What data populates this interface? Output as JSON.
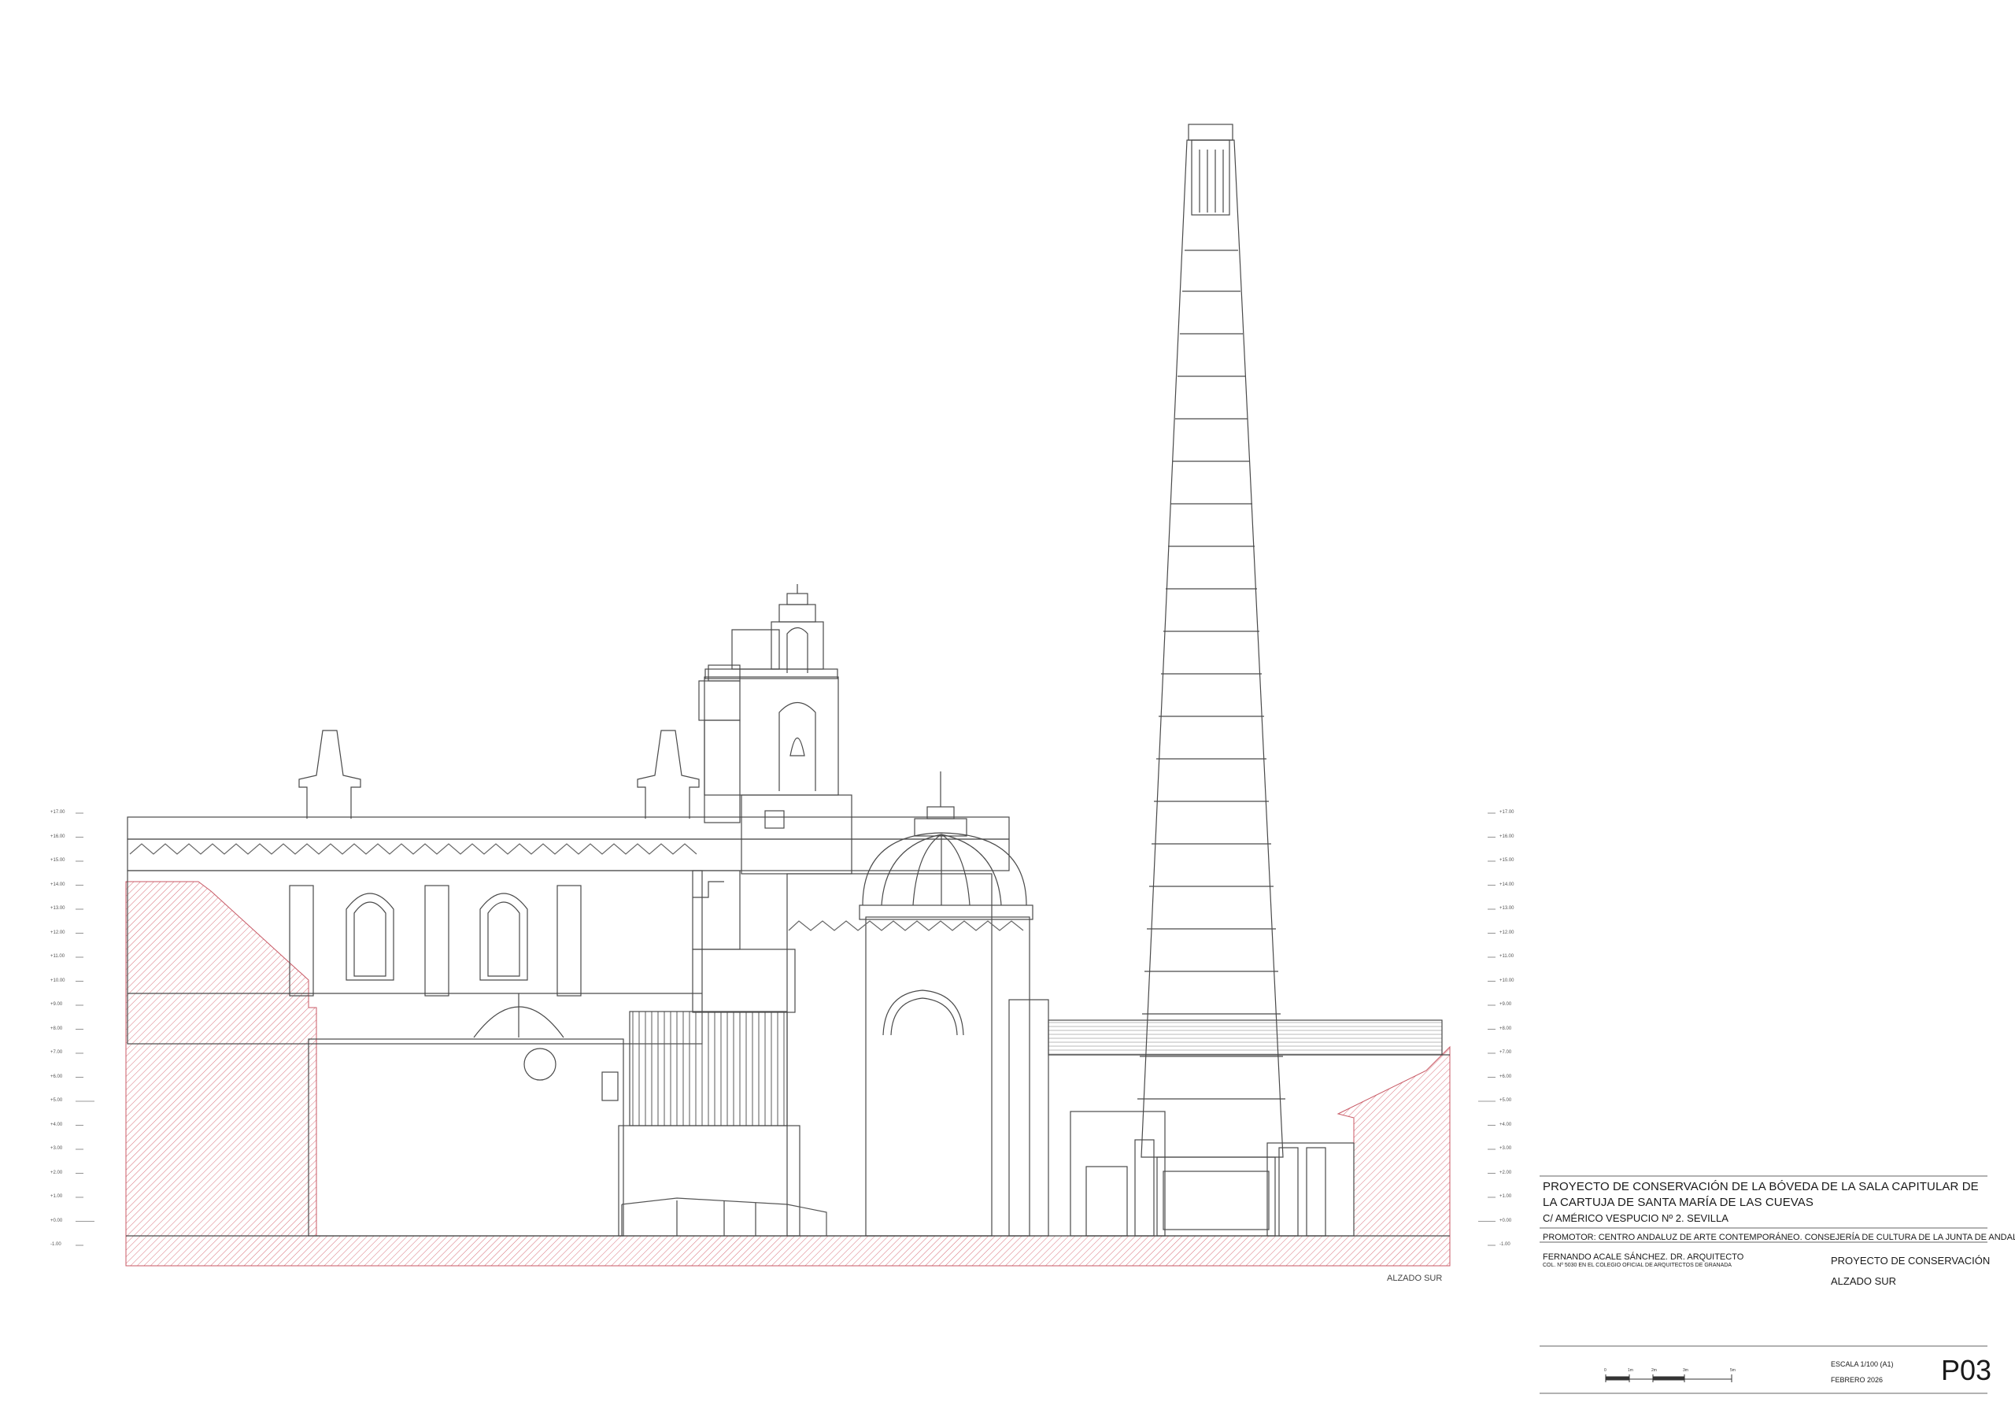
{
  "drawing": {
    "view_label": "ALZADO SUR",
    "levels_left": [
      "+17.00",
      "+16.00",
      "+15.00",
      "+14.00",
      "+13.00",
      "+12.00",
      "+11.00",
      "+10.00",
      "+9.00",
      "+8.00",
      "+7.00",
      "+6.00",
      "+5.00",
      "+4.00",
      "+3.00",
      "+2.00",
      "+1.00",
      "+0.00",
      "-1.00"
    ],
    "levels_right": [
      "+17.00",
      "+16.00",
      "+15.00",
      "+14.00",
      "+13.00",
      "+12.00",
      "+11.00",
      "+10.00",
      "+9.00",
      "+8.00",
      "+7.00",
      "+6.00",
      "+5.00",
      "+4.00",
      "+3.00",
      "+2.00",
      "+1.00",
      "+0.00",
      "-1.00"
    ],
    "colors": {
      "line": "#4a4a4a",
      "section_hatch": "#d9707a",
      "title_rule": "#666666"
    }
  },
  "title_block": {
    "title": "PROYECTO DE CONSERVACIÓN DE LA BÓVEDA DE LA SALA CAPITULAR DE LA CARTUJA DE SANTA MARÍA DE LAS CUEVAS",
    "address": "C/ AMÉRICO VESPUCIO Nº 2. SEVILLA",
    "promoter": "PROMOTOR: CENTRO ANDALUZ DE ARTE CONTEMPORÁNEO. CONSEJERÍA DE CULTURA DE LA JUNTA DE ANDALUCÍA",
    "architect": "FERNANDO ACALE SÁNCHEZ. DR. ARQUITECTO",
    "college": "COL. Nº 5030 EN EL COLEGIO OFICIAL DE ARQUITECTOS DE GRANADA",
    "project": "PROYECTO DE CONSERVACIÓN",
    "view": "ALZADO SUR",
    "scale": "ESCALA 1/100 (A1)",
    "date": "FEBRERO 2026",
    "sheet_number": "P03",
    "scale_bar_labels": [
      "0",
      "1m",
      "2m",
      "3m",
      "5m"
    ]
  }
}
